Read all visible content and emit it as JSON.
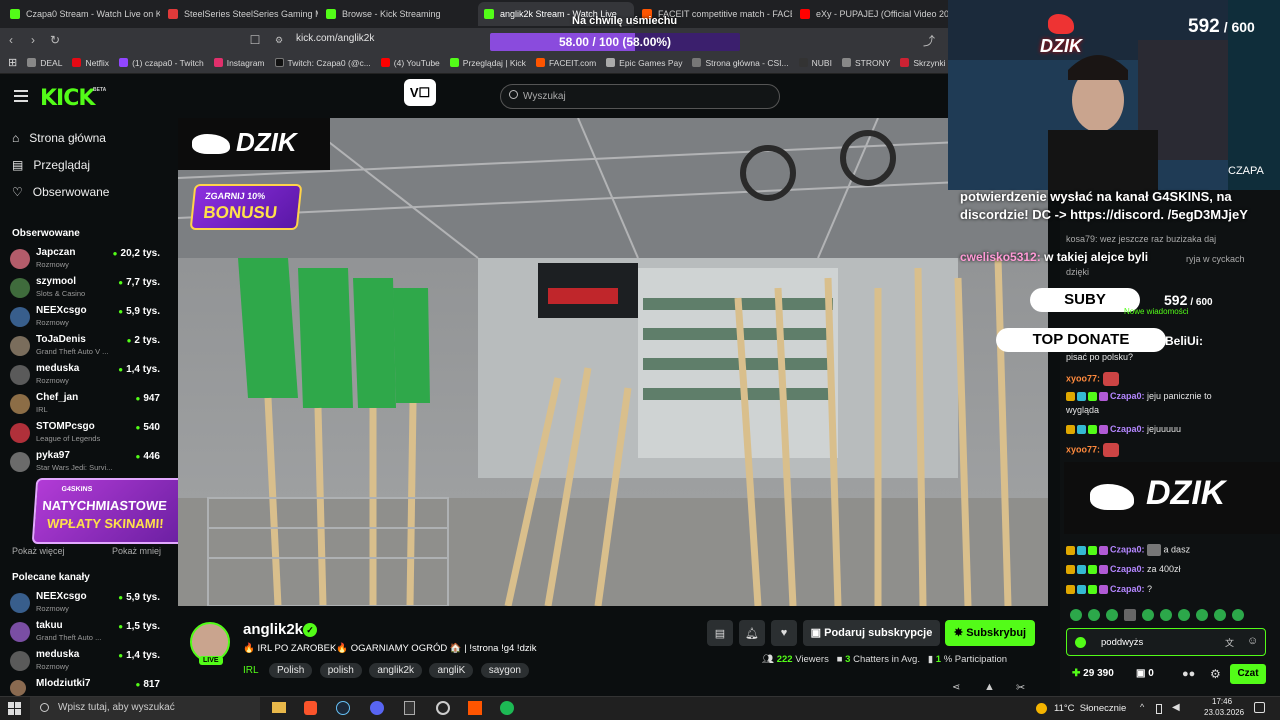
{
  "browser": {
    "tabs": [
      {
        "label": "Czapa0 Stream - Watch Live on Kick",
        "color": "#53fc18"
      },
      {
        "label": "SteelSeries SteelSeries Gaming Mou",
        "color": "#e03a3a"
      },
      {
        "label": "Browse - Kick Streaming",
        "color": "#53fc18"
      },
      {
        "label": "anglik2k Stream - Watch Live",
        "color": "#53fc18"
      },
      {
        "label": "FACEIT competitive match - FACEIT.c",
        "color": "#ff5500"
      },
      {
        "label": "eXy - PUPAJEJ (Official Video 20",
        "color": "#ff0000"
      }
    ],
    "url": "kick.com/anglik2k",
    "bookmarks": [
      {
        "label": "DEAL",
        "color": "#888"
      },
      {
        "label": "Netflix",
        "color": "#e50914"
      },
      {
        "label": "(1) czapa0 - Twitch",
        "color": "#9146ff"
      },
      {
        "label": "Instagram",
        "color": "#e1306c"
      },
      {
        "label": "Twitch: Czapa0 (@c...",
        "color": "#000"
      },
      {
        "label": "(4) YouTube",
        "color": "#ff0000"
      },
      {
        "label": "Przeglądaj | Kick",
        "color": "#53fc18"
      },
      {
        "label": "FACEIT.com",
        "color": "#ff5500"
      },
      {
        "label": "Epic Games Pay",
        "color": "#aaa"
      },
      {
        "label": "Strona główna - CSI...",
        "color": "#777"
      },
      {
        "label": "NUBI",
        "color": "#333"
      },
      {
        "label": "STRONY",
        "color": "#888"
      },
      {
        "label": "Skrzynki CS:...",
        "color": "#c23"
      }
    ]
  },
  "overlay": {
    "goal_text": "58.00 / 100 (58.00%)",
    "goal_fraction": 0.58,
    "smile_text": "Na chwilę uśmiechu",
    "sub_count": "592",
    "sub_goal": "/ 600",
    "dzik_logo": "DZIK",
    "cam_name": "CZAPA",
    "alert_text": "potwierdzenie wysłać na kanał G4SKINS, na discordzie! DC -> https://discord. /5egD3MJjeY",
    "alert_user": "cwelisko5312:",
    "alert_msg": "w takiej alejce byli",
    "suby_label": "SUBY",
    "suby_count": "592",
    "suby_goal": "/ 600",
    "top_donate_label": "TOP DONATE",
    "top_donate_user": "BeliUi:",
    "video_banner": "DZIK",
    "bonus_line1": "ZGARNIJ 10%",
    "bonus_line2": "BONUSU",
    "g4_brand": "G4SKINS",
    "g4_line1": "NATYCHMIASTOWE",
    "g4_line2": "WPŁATY SKINAMI!"
  },
  "kick": {
    "logo": "KICK",
    "logo_tag": "BETA",
    "search_placeholder": "Wyszukaj",
    "nav": [
      {
        "label": "Strona główna"
      },
      {
        "label": "Przeglądaj"
      },
      {
        "label": "Obserwowane"
      }
    ],
    "followed_header": "Obserwowane",
    "followed": [
      {
        "name": "Japczan",
        "cat": "Rozmowy",
        "viewers": "20,2 tys."
      },
      {
        "name": "szymool",
        "cat": "Slots & Casino",
        "viewers": "7,7 tys."
      },
      {
        "name": "NEEXcsgo",
        "cat": "Rozmowy",
        "viewers": "5,9 tys."
      },
      {
        "name": "ToJaDenis",
        "cat": "Grand Theft Auto V ...",
        "viewers": "2 tys."
      },
      {
        "name": "meduska",
        "cat": "Rozmowy",
        "viewers": "1,4 tys."
      },
      {
        "name": "Chef_jan",
        "cat": "IRL",
        "viewers": "947"
      },
      {
        "name": "STOMPcsgo",
        "cat": "League of Legends",
        "viewers": "540"
      },
      {
        "name": "pyka97",
        "cat": "Star Wars Jedi: Survi...",
        "viewers": "446"
      }
    ],
    "show_more": "Pokaż więcej",
    "show_less": "Pokaż mniej",
    "recommended_header": "Polecane kanały",
    "recommended": [
      {
        "name": "NEEXcsgo",
        "cat": "Rozmowy",
        "viewers": "5,9 tys."
      },
      {
        "name": "takuu",
        "cat": "Grand Theft Auto ...",
        "viewers": "1,5 tys."
      },
      {
        "name": "meduska",
        "cat": "Rozmowy",
        "viewers": "1,4 tys."
      },
      {
        "name": "Mlodziutki7",
        "cat": "",
        "viewers": "817"
      }
    ],
    "stream": {
      "channel": "anglik2k",
      "live_badge": "LIVE",
      "title": "🔥 IRL PO ZAROBEK🔥 OGARNIAMY OGRÓD 🏠 | !strona !g4 !dzik",
      "category": "IRL",
      "tags": [
        "Polish",
        "polish",
        "anglik2k",
        "angliK",
        "saygon"
      ],
      "subscribe_gift": "Podaruj subskrypcje",
      "subscribe": "Subskrybuj",
      "viewers_num": "222",
      "viewers_label": "Viewers",
      "chatters_num": "3",
      "chatters_label": "Chatters in Avg.",
      "participation_num": "1",
      "participation_label": "% Participation"
    }
  },
  "chat": {
    "messages": [
      {
        "user": "kosa79:",
        "text": "wez jeszcze raz buzizaka daj"
      },
      {
        "user": "",
        "text": "ryja w cyckach"
      },
      {
        "user": "",
        "text": "dzięki"
      },
      {
        "user": "",
        "text": "Nowe wiadomości"
      },
      {
        "user": "",
        "text": "pisać po polsku?"
      },
      {
        "user": "xyoo77:",
        "text": ""
      },
      {
        "user": "Czapa0:",
        "text": "jeju panicznie to"
      },
      {
        "user": "",
        "text": "wygląda"
      },
      {
        "user": "Czapa0:",
        "text": "jejuuuuu"
      },
      {
        "user": "xyoo77:",
        "text": ""
      },
      {
        "user": "Czapa0:",
        "text": "a dasz"
      },
      {
        "user": "Czapa0:",
        "text": "za 400zł"
      },
      {
        "user": "Czapa0:",
        "text": "?"
      }
    ],
    "input_value": "poddwyżs",
    "points": "29 390",
    "second_count": "0",
    "send_label": "Czat"
  },
  "taskbar": {
    "search_placeholder": "Wpisz tutaj, aby wyszukać",
    "weather": "11°C  Słonecznie",
    "time": "17:46",
    "date": "23.03.2026"
  }
}
